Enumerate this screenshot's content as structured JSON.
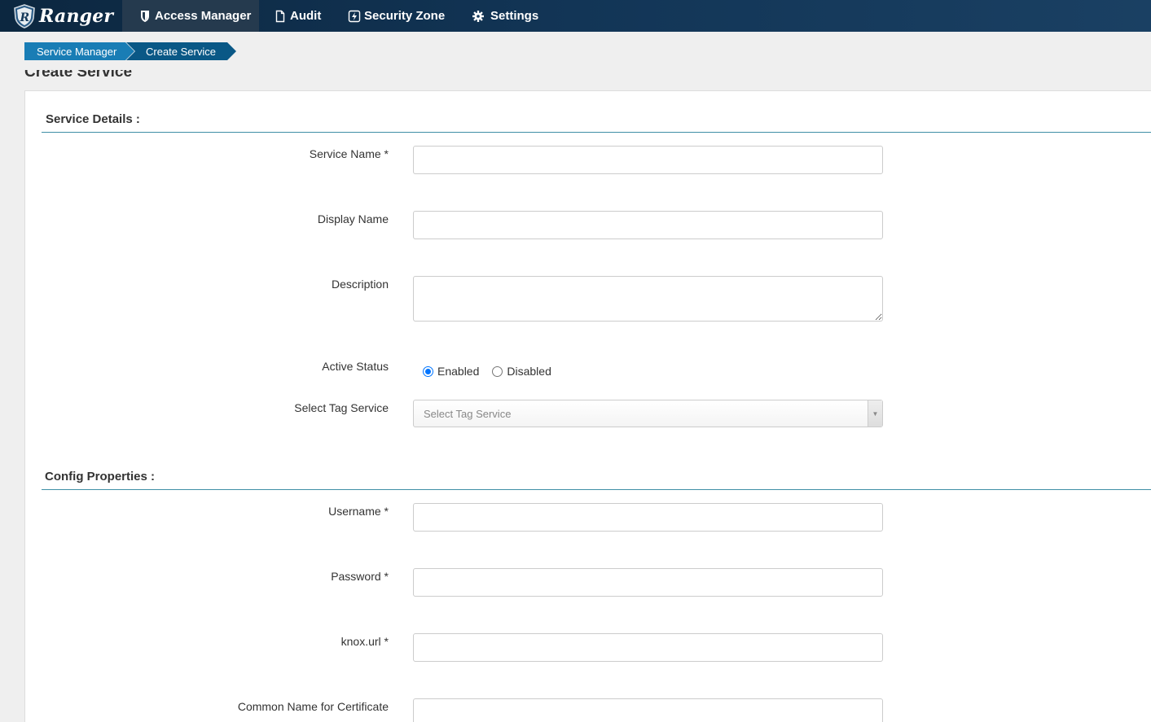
{
  "navbar": {
    "brand": "Ranger",
    "items": [
      {
        "label": "Access Manager",
        "icon": "shield-icon",
        "active": true
      },
      {
        "label": "Audit",
        "icon": "file-icon",
        "active": false
      },
      {
        "label": "Security Zone",
        "icon": "bolt-icon",
        "active": false
      },
      {
        "label": "Settings",
        "icon": "gear-icon",
        "active": false
      }
    ]
  },
  "breadcrumb": [
    "Service Manager",
    "Create Service"
  ],
  "page_title": "Create Service",
  "service_details": {
    "title": "Service Details :",
    "service_name_label": "Service Name *",
    "service_name_value": "",
    "display_name_label": "Display Name",
    "display_name_value": "",
    "description_label": "Description",
    "description_value": "",
    "active_status_label": "Active Status",
    "status_options": [
      "Enabled",
      "Disabled"
    ],
    "status_selected": "Enabled",
    "tag_service_label": "Select Tag Service",
    "tag_service_placeholder": "Select Tag Service"
  },
  "config_properties": {
    "title": "Config Properties :",
    "username_label": "Username *",
    "password_label": "Password *",
    "knox_url_label": "knox.url *",
    "common_name_label": "Common Name for Certificate"
  },
  "colors": {
    "navbar": "#123556",
    "breadcrumb_primary": "#197db5",
    "breadcrumb_active": "#0a5886",
    "section_rule": "#3f8fa6",
    "radio_accent": "#0075ff"
  }
}
